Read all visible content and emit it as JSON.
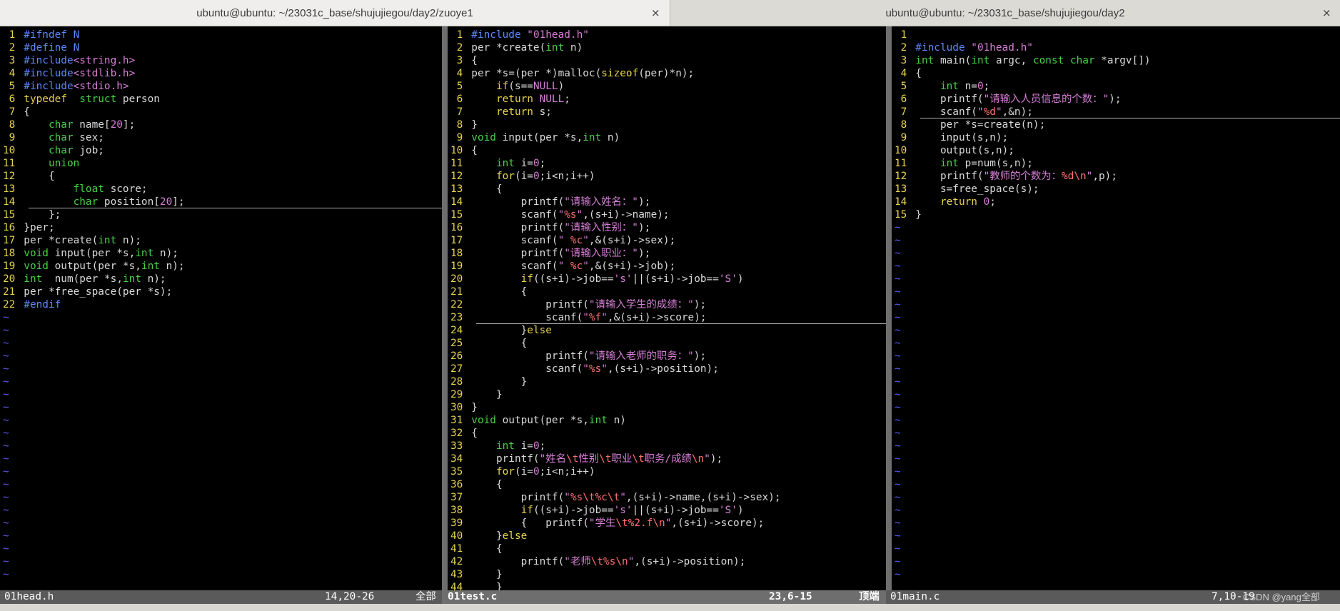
{
  "tabs": [
    {
      "title": "ubuntu@ubuntu: ~/23031c_base/shujujiegou/day2/zuoye1",
      "close": "×"
    },
    {
      "title": "ubuntu@ubuntu: ~/23031c_base/shujujiegou/day2",
      "close": "×"
    }
  ],
  "panes": [
    {
      "filename": "01head.h",
      "position": "14,20-26",
      "scroll": "全部",
      "cursor_line": 14,
      "lines": [
        [
          [
            "pp",
            "#ifndef N"
          ]
        ],
        [
          [
            "pp",
            "#define N"
          ]
        ],
        [
          [
            "pp",
            "#include"
          ],
          [
            "st",
            "<string.h>"
          ]
        ],
        [
          [
            "pp",
            "#include"
          ],
          [
            "st",
            "<stdlib.h>"
          ]
        ],
        [
          [
            "pp",
            "#include"
          ],
          [
            "st",
            "<stdio.h>"
          ]
        ],
        [
          [
            "kw",
            "typedef"
          ],
          [
            "",
            "  "
          ],
          [
            "ty",
            "struct"
          ],
          [
            "",
            " person"
          ]
        ],
        [
          [
            "",
            "{"
          ]
        ],
        [
          [
            "",
            "    "
          ],
          [
            "ty",
            "char"
          ],
          [
            "",
            " name["
          ],
          [
            "nu",
            "20"
          ],
          [
            "",
            "];"
          ]
        ],
        [
          [
            "",
            "    "
          ],
          [
            "ty",
            "char"
          ],
          [
            "",
            " sex;"
          ]
        ],
        [
          [
            "",
            "    "
          ],
          [
            "ty",
            "char"
          ],
          [
            "",
            " job;"
          ]
        ],
        [
          [
            "",
            "    "
          ],
          [
            "ty",
            "union"
          ]
        ],
        [
          [
            "",
            "    {"
          ]
        ],
        [
          [
            "",
            "        "
          ],
          [
            "ty",
            "float"
          ],
          [
            "",
            " score;"
          ]
        ],
        [
          [
            "",
            "        "
          ],
          [
            "ty",
            "char"
          ],
          [
            "",
            " position["
          ],
          [
            "nu",
            "20"
          ],
          [
            "",
            "];"
          ]
        ],
        [
          [
            "",
            "    };"
          ]
        ],
        [
          [
            "",
            "}per;"
          ]
        ],
        [
          [
            "",
            "per *create("
          ],
          [
            "ty",
            "int"
          ],
          [
            "",
            " n);"
          ]
        ],
        [
          [
            "ty",
            "void"
          ],
          [
            "",
            " input(per *s,"
          ],
          [
            "ty",
            "int"
          ],
          [
            "",
            " n);"
          ]
        ],
        [
          [
            "ty",
            "void"
          ],
          [
            "",
            " output(per *s,"
          ],
          [
            "ty",
            "int"
          ],
          [
            "",
            " n);"
          ]
        ],
        [
          [
            "ty",
            "int"
          ],
          [
            "",
            "  num(per *s,"
          ],
          [
            "ty",
            "int"
          ],
          [
            "",
            " n);"
          ]
        ],
        [
          [
            "",
            "per *free_space(per *s);"
          ]
        ],
        [
          [
            "pp",
            "#endif"
          ]
        ]
      ]
    },
    {
      "filename": "01test.c",
      "position": "23,6-15",
      "scroll": "顶端",
      "cursor_line": 23,
      "lines": [
        [
          [
            "pp",
            "#include "
          ],
          [
            "st",
            "\"01head.h\""
          ]
        ],
        [
          [
            "",
            "per *create("
          ],
          [
            "ty",
            "int"
          ],
          [
            "",
            " n)"
          ]
        ],
        [
          [
            "",
            "{"
          ]
        ],
        [
          [
            "",
            "per *s=(per *)malloc("
          ],
          [
            "kw",
            "sizeof"
          ],
          [
            "",
            "(per)*n);"
          ]
        ],
        [
          [
            "",
            "    "
          ],
          [
            "kw",
            "if"
          ],
          [
            "",
            "(s=="
          ],
          [
            "nu",
            "NULL"
          ],
          [
            "",
            ")"
          ]
        ],
        [
          [
            "",
            "    "
          ],
          [
            "kw",
            "return"
          ],
          [
            "",
            " "
          ],
          [
            "nu",
            "NULL"
          ],
          [
            "",
            ";"
          ]
        ],
        [
          [
            "",
            "    "
          ],
          [
            "kw",
            "return"
          ],
          [
            "",
            " s;"
          ]
        ],
        [
          [
            "",
            "}"
          ]
        ],
        [
          [
            "ty",
            "void"
          ],
          [
            "",
            " input(per *s,"
          ],
          [
            "ty",
            "int"
          ],
          [
            "",
            " n)"
          ]
        ],
        [
          [
            "",
            "{"
          ]
        ],
        [
          [
            "",
            "    "
          ],
          [
            "ty",
            "int"
          ],
          [
            "",
            " i="
          ],
          [
            "nu",
            "0"
          ],
          [
            "",
            ";"
          ]
        ],
        [
          [
            "",
            "    "
          ],
          [
            "kw",
            "for"
          ],
          [
            "",
            "(i="
          ],
          [
            "nu",
            "0"
          ],
          [
            "",
            ";i<n;i++)"
          ]
        ],
        [
          [
            "",
            "    {"
          ]
        ],
        [
          [
            "",
            "        printf("
          ],
          [
            "st",
            "\"请输入姓名："
          ],
          [
            "st",
            "\""
          ],
          [
            "",
            ");"
          ]
        ],
        [
          [
            "",
            "        scanf("
          ],
          [
            "st",
            "\""
          ],
          [
            "sp",
            "%s"
          ],
          [
            "st",
            "\""
          ],
          [
            "",
            ",(s+i)->name);"
          ]
        ],
        [
          [
            "",
            "        printf("
          ],
          [
            "st",
            "\"请输入性别：\""
          ],
          [
            "",
            ");"
          ]
        ],
        [
          [
            "",
            "        scanf("
          ],
          [
            "st",
            "\" "
          ],
          [
            "sp",
            "%c"
          ],
          [
            "st",
            "\""
          ],
          [
            "",
            ",&(s+i)->sex);"
          ]
        ],
        [
          [
            "",
            "        printf("
          ],
          [
            "st",
            "\"请输入职业：\""
          ],
          [
            "",
            ");"
          ]
        ],
        [
          [
            "",
            "        scanf("
          ],
          [
            "st",
            "\" "
          ],
          [
            "sp",
            "%c"
          ],
          [
            "st",
            "\""
          ],
          [
            "",
            ",&(s+i)->job);"
          ]
        ],
        [
          [
            "",
            "        "
          ],
          [
            "kw",
            "if"
          ],
          [
            "",
            "((s+i)->job=="
          ],
          [
            "st",
            "'s'"
          ],
          [
            "",
            "||(s+i)->job=="
          ],
          [
            "st",
            "'S'"
          ],
          [
            "",
            ")"
          ]
        ],
        [
          [
            "",
            "        {"
          ]
        ],
        [
          [
            "",
            "            printf("
          ],
          [
            "st",
            "\"请输入学生的成绩：\""
          ],
          [
            "",
            ");"
          ]
        ],
        [
          [
            "",
            "            scanf("
          ],
          [
            "st",
            "\""
          ],
          [
            "sp",
            "%f"
          ],
          [
            "st",
            "\""
          ],
          [
            "",
            ",&(s+i)->score);"
          ]
        ],
        [
          [
            "",
            "        }"
          ],
          [
            "kw",
            "else"
          ]
        ],
        [
          [
            "",
            "        {"
          ]
        ],
        [
          [
            "",
            "            printf("
          ],
          [
            "st",
            "\"请输入老师的职务：\""
          ],
          [
            "",
            ");"
          ]
        ],
        [
          [
            "",
            "            scanf("
          ],
          [
            "st",
            "\""
          ],
          [
            "sp",
            "%s"
          ],
          [
            "st",
            "\""
          ],
          [
            "",
            ",(s+i)->position);"
          ]
        ],
        [
          [
            "",
            "        }"
          ]
        ],
        [
          [
            "",
            "    }"
          ]
        ],
        [
          [
            "",
            "}"
          ]
        ],
        [
          [
            "ty",
            "void"
          ],
          [
            "",
            " output(per *s,"
          ],
          [
            "ty",
            "int"
          ],
          [
            "",
            " n)"
          ]
        ],
        [
          [
            "",
            "{"
          ]
        ],
        [
          [
            "",
            "    "
          ],
          [
            "ty",
            "int"
          ],
          [
            "",
            " i="
          ],
          [
            "nu",
            "0"
          ],
          [
            "",
            ";"
          ]
        ],
        [
          [
            "",
            "    printf("
          ],
          [
            "st",
            "\"姓名"
          ],
          [
            "sp",
            "\\t"
          ],
          [
            "st",
            "性别"
          ],
          [
            "sp",
            "\\t"
          ],
          [
            "st",
            "职业"
          ],
          [
            "sp",
            "\\t"
          ],
          [
            "st",
            "职务/成绩"
          ],
          [
            "sp",
            "\\n"
          ],
          [
            "st",
            "\""
          ],
          [
            "",
            ");"
          ]
        ],
        [
          [
            "",
            "    "
          ],
          [
            "kw",
            "for"
          ],
          [
            "",
            "(i="
          ],
          [
            "nu",
            "0"
          ],
          [
            "",
            ";i<n;i++)"
          ]
        ],
        [
          [
            "",
            "    {"
          ]
        ],
        [
          [
            "",
            "        printf("
          ],
          [
            "st",
            "\""
          ],
          [
            "sp",
            "%s\\t%c\\t"
          ],
          [
            "st",
            "\""
          ],
          [
            "",
            ",(s+i)->name,(s+i)->sex);"
          ]
        ],
        [
          [
            "",
            "        "
          ],
          [
            "kw",
            "if"
          ],
          [
            "",
            "((s+i)->job=="
          ],
          [
            "st",
            "'s'"
          ],
          [
            "",
            "||(s+i)->job=="
          ],
          [
            "st",
            "'S'"
          ],
          [
            "",
            ")"
          ]
        ],
        [
          [
            "",
            "        {   printf("
          ],
          [
            "st",
            "\"学生"
          ],
          [
            "sp",
            "\\t%2.f\\n"
          ],
          [
            "st",
            "\""
          ],
          [
            "",
            ",(s+i)->score);"
          ]
        ],
        [
          [
            "",
            "    }"
          ],
          [
            "kw",
            "else"
          ]
        ],
        [
          [
            "",
            "    {"
          ]
        ],
        [
          [
            "",
            "        printf("
          ],
          [
            "st",
            "\"老师"
          ],
          [
            "sp",
            "\\t%s\\n"
          ],
          [
            "st",
            "\""
          ],
          [
            "",
            ",(s+i)->position);"
          ]
        ],
        [
          [
            "",
            "    }"
          ]
        ],
        [
          [
            "",
            "    }"
          ]
        ]
      ]
    },
    {
      "filename": "01main.c",
      "position": "7,10-19",
      "scroll": "全部",
      "cursor_line": 7,
      "lines": [
        [
          [
            "",
            ""
          ]
        ],
        [
          [
            "pp",
            "#include "
          ],
          [
            "st",
            "\"01head.h\""
          ]
        ],
        [
          [
            "ty",
            "int"
          ],
          [
            "",
            " main("
          ],
          [
            "ty",
            "int"
          ],
          [
            "",
            " argc, "
          ],
          [
            "ty",
            "const"
          ],
          [
            "",
            " "
          ],
          [
            "ty",
            "char"
          ],
          [
            "",
            " *argv[])"
          ]
        ],
        [
          [
            "",
            "{"
          ]
        ],
        [
          [
            "",
            "    "
          ],
          [
            "ty",
            "int"
          ],
          [
            "",
            " n="
          ],
          [
            "nu",
            "0"
          ],
          [
            "",
            ";"
          ]
        ],
        [
          [
            "",
            "    printf("
          ],
          [
            "st",
            "\"请输入人员信息的个数：\""
          ],
          [
            "",
            ");"
          ]
        ],
        [
          [
            "",
            "    scanf("
          ],
          [
            "st",
            "\""
          ],
          [
            "sp",
            "%d"
          ],
          [
            "st",
            "\""
          ],
          [
            "",
            ",&n);"
          ]
        ],
        [
          [
            "",
            "    per *s=create(n);"
          ]
        ],
        [
          [
            "",
            "    input(s,n);"
          ]
        ],
        [
          [
            "",
            "    output(s,n);"
          ]
        ],
        [
          [
            "",
            "    "
          ],
          [
            "ty",
            "int"
          ],
          [
            "",
            " p=num(s,n);"
          ]
        ],
        [
          [
            "",
            "    printf("
          ],
          [
            "st",
            "\"教师的个数为："
          ],
          [
            "sp",
            "%d\\n"
          ],
          [
            "st",
            "\""
          ],
          [
            "",
            ",p);"
          ]
        ],
        [
          [
            "",
            "    s=free_space(s);"
          ]
        ],
        [
          [
            "",
            "    "
          ],
          [
            "kw",
            "return"
          ],
          [
            "",
            " "
          ],
          [
            "nu",
            "0"
          ],
          [
            "",
            ";"
          ]
        ],
        [
          [
            "",
            "}"
          ]
        ]
      ]
    }
  ],
  "watermark": "CSDN @yang全部",
  "colors": {
    "background": "#000000",
    "line_number": "#e6d24c",
    "tilde": "#5b5bff",
    "status_bar": "#5a5a5a",
    "preprocessor": "#5f87ff",
    "type": "#48d048",
    "string": "#d77fd7",
    "keyword": "#e6d24c",
    "special": "#ff7070"
  }
}
